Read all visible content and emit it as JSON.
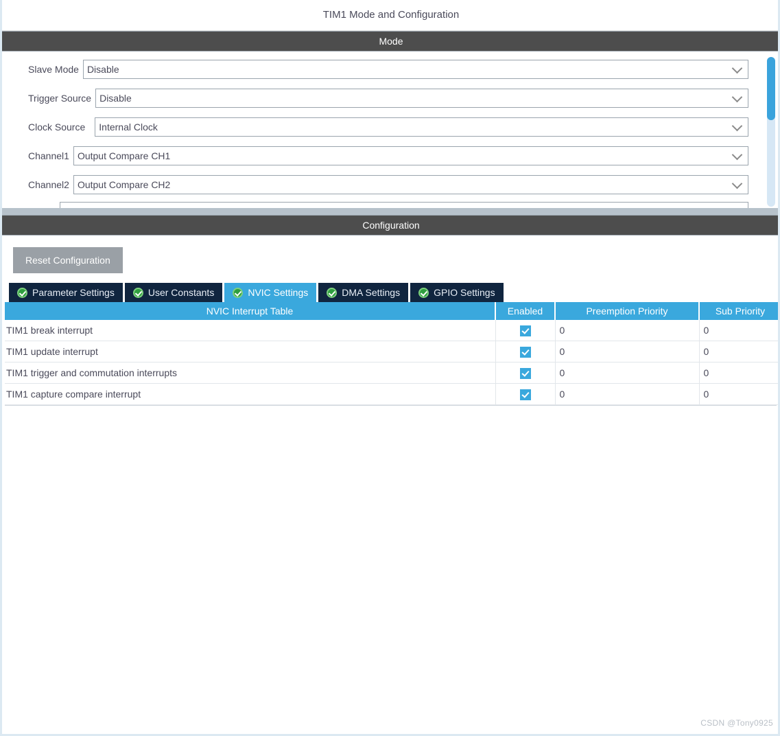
{
  "window": {
    "title": "TIM1 Mode and Configuration"
  },
  "mode_section": {
    "header": "Mode",
    "fields": [
      {
        "label": "Slave Mode",
        "value": "Disable"
      },
      {
        "label": "Trigger Source",
        "value": "Disable"
      },
      {
        "label": "Clock Source",
        "value": "Internal Clock"
      },
      {
        "label": "Channel1",
        "value": "Output Compare CH1"
      },
      {
        "label": "Channel2",
        "value": "Output Compare CH2"
      }
    ],
    "chevron_icon": "chevron-down-icon",
    "scrollbar": {
      "track_color": "#d6e7f5",
      "thumb_color": "#3aa3dc"
    }
  },
  "configuration_section": {
    "header": "Configuration",
    "reset_button": "Reset Configuration",
    "tabs": [
      {
        "label": "Parameter Settings",
        "icon": "green-check-icon",
        "active": false
      },
      {
        "label": "User Constants",
        "icon": "green-check-icon",
        "active": false
      },
      {
        "label": "NVIC Settings",
        "icon": "green-check-icon",
        "active": true
      },
      {
        "label": "DMA Settings",
        "icon": "green-check-icon",
        "active": false
      },
      {
        "label": "GPIO Settings",
        "icon": "green-check-icon",
        "active": false
      }
    ],
    "nvic_table": {
      "columns": [
        "NVIC Interrupt Table",
        "Enabled",
        "Preemption Priority",
        "Sub Priority"
      ],
      "rows": [
        {
          "name": "TIM1 break interrupt",
          "enabled": true,
          "preemption": "0",
          "sub": "0"
        },
        {
          "name": "TIM1 update interrupt",
          "enabled": true,
          "preemption": "0",
          "sub": "0"
        },
        {
          "name": "TIM1 trigger and commutation interrupts",
          "enabled": true,
          "preemption": "0",
          "sub": "0"
        },
        {
          "name": "TIM1 capture compare interrupt",
          "enabled": true,
          "preemption": "0",
          "sub": "0"
        }
      ]
    }
  },
  "watermark": "CSDN @Tony0925",
  "colors": {
    "accent_blue": "#3aa8dd",
    "tab_dark": "#10253f",
    "section_bar": "#4d4d4d",
    "button_grey": "#9aa0a6",
    "check_green": "#2f9e3f"
  }
}
